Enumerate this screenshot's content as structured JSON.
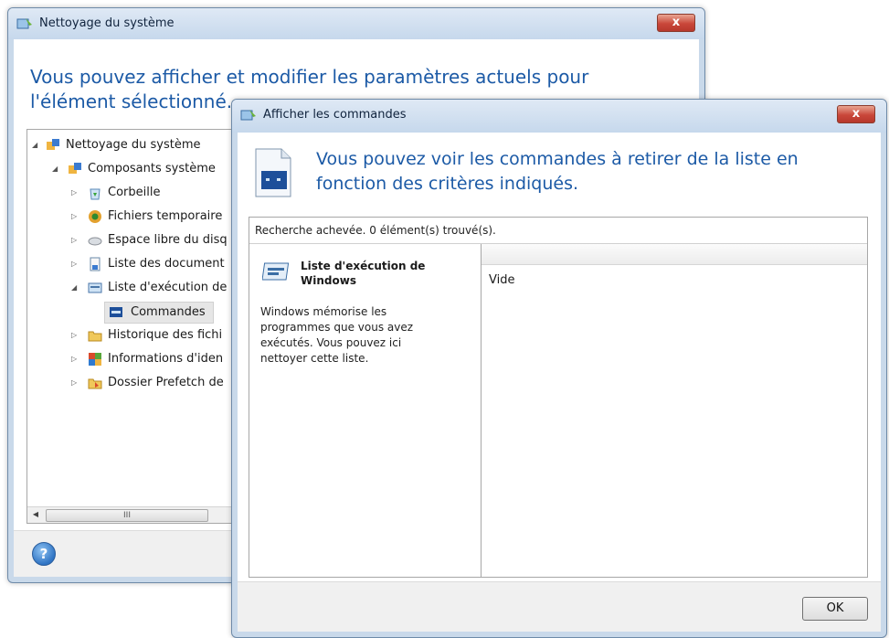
{
  "back_window": {
    "title": "Nettoyage du système",
    "close_label": "x",
    "heading": "Vous pouvez afficher et modifier les paramètres actuels pour l'élément sélectionné.",
    "tree": [
      {
        "label": "Nettoyage du système",
        "icon": "cleanup-icon",
        "state": "expanded"
      },
      {
        "label": "Composants système",
        "icon": "components-icon",
        "state": "expanded"
      },
      {
        "label": "Corbeille",
        "icon": "recycle-bin-icon",
        "state": "collapsed"
      },
      {
        "label": "Fichiers temporaire",
        "icon": "temp-files-icon",
        "state": "collapsed"
      },
      {
        "label": "Espace libre du disq",
        "icon": "disk-icon",
        "state": "collapsed"
      },
      {
        "label": "Liste des document",
        "icon": "documents-icon",
        "state": "collapsed"
      },
      {
        "label": "Liste d'exécution de",
        "icon": "run-list-icon",
        "state": "expanded"
      },
      {
        "label": "Commandes",
        "icon": "commands-icon",
        "state": "leaf",
        "selected": true
      },
      {
        "label": "Historique des fichi",
        "icon": "history-icon",
        "state": "collapsed"
      },
      {
        "label": "Informations d'iden",
        "icon": "identity-icon",
        "state": "collapsed"
      },
      {
        "label": "Dossier Prefetch de",
        "icon": "prefetch-icon",
        "state": "collapsed"
      }
    ],
    "scroll_thumb_label": "III",
    "help_label": "?"
  },
  "front_window": {
    "title": "Afficher les commandes",
    "close_label": "x",
    "heading": "Vous pouvez voir les commandes à retirer de la liste en fonction des critères indiqués.",
    "status": "Recherche achevée. 0 élément(s) trouvé(s).",
    "section_title": "Liste d'exécution de Windows",
    "section_description": "Windows mémorise les programmes que vous avez exécutés. Vous pouvez ici nettoyer cette liste.",
    "list_content": "Vide",
    "ok_label": "OK"
  },
  "colors": {
    "heading_blue": "#1c5aa6",
    "frame": "#c9d9ea",
    "close_red": "#c9473a"
  }
}
